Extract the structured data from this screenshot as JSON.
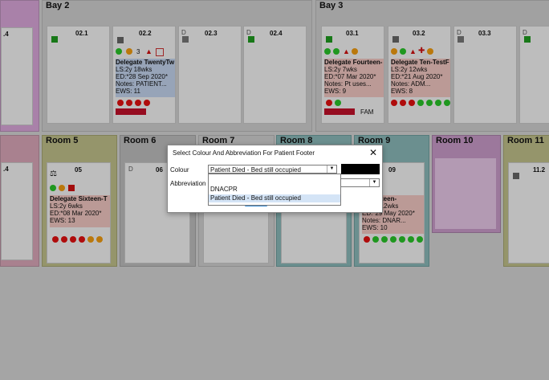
{
  "bays": {
    "bay2": {
      "label": "Bay 2"
    },
    "bay3": {
      "label": "Bay 3"
    },
    "left_partial_bed": {
      "number": ".4"
    },
    "left_partial_room_bed": {
      "number": ".4"
    }
  },
  "beds": {
    "b021": {
      "number": "02.1"
    },
    "b022": {
      "number": "02.2",
      "count": "3",
      "lines": [
        "Delegate TwentyTw",
        "LS:2y 18wks",
        "ED:*28 Sep 2020*",
        "Notes: PATIENT...",
        "EWS: 11"
      ]
    },
    "b023": {
      "number": "02.3",
      "dmark": "D"
    },
    "b024": {
      "number": "02.4",
      "dmark": "D"
    },
    "b031": {
      "number": "03.1",
      "lines": [
        "Delegate Fourteen-",
        "LS:2y 7wks",
        "ED:*07 Mar 2020*",
        "Notes: Pt uses...",
        "EWS: 9"
      ],
      "footer": "FAM"
    },
    "b032": {
      "number": "03.2",
      "lines": [
        "Delegate Ten-TestF",
        "LS:2y 12wks",
        "ED:*21 Aug 2020*",
        "Notes: ADM...",
        "EWS: 8"
      ]
    },
    "b033": {
      "number": "03.3",
      "dmark": "D"
    },
    "b034": {
      "dmark": "D"
    }
  },
  "rooms": {
    "room5": {
      "label": "Room 5",
      "bed": "05",
      "lines": [
        "Delegate Sixteen-T",
        "LS:2y 6wks",
        "ED:*08 Mar 2020*",
        "EWS: 13"
      ]
    },
    "room6": {
      "label": "Room 6",
      "bed": "06",
      "dmark": "D"
    },
    "room7": {
      "label": "Room 7"
    },
    "room8": {
      "label": "Room 8"
    },
    "room9": {
      "label": "Room 9",
      "bed": "09",
      "lines": [
        "e Eighteen-",
        "LS:2y 12wks",
        "ED:*29 May 2020*",
        "Notes: DNAR...",
        "EWS: 10"
      ]
    },
    "room10": {
      "label": "Room 10"
    },
    "room11": {
      "label": "Room 11",
      "bed": "11.2"
    }
  },
  "dialog": {
    "title": "Select Colour And Abbreviation For Patient Footer",
    "close": "✕",
    "colour_label": "Colour",
    "colour_value": "Patient Died - Bed still occupied",
    "abbreviation_label": "Abbreviation",
    "options": [
      "DNACPR",
      "Patient Died - Bed still occupied"
    ],
    "swatch_color": "#000000"
  },
  "colors": {
    "room5": "#bfbf8a",
    "room6": "#bdbdbd",
    "room8": "#8ab8b8",
    "room9": "#8ab8b8",
    "room10": "#c89ac8",
    "room11": "#bfbf8a",
    "card_blue": "#c2d3ec",
    "card_pink": "#f0c6c0"
  }
}
